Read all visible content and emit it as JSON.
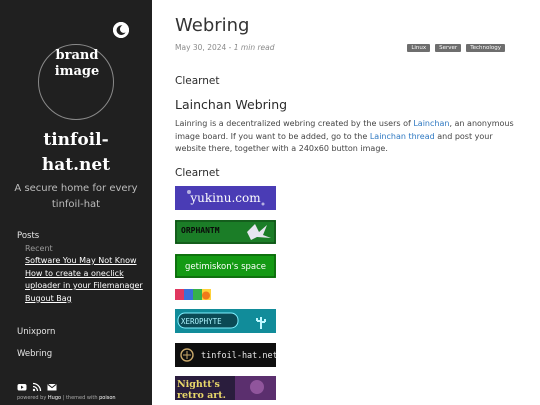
{
  "sidebar": {
    "brand_image_alt": "brand image",
    "site_title": "tinfoil-hat.net",
    "tagline": "A secure home for every tinfoil-hat",
    "nav": {
      "posts_label": "Posts",
      "recent_label": "Recent",
      "recent_posts": [
        "Software You May Not Know",
        "How to create a oneclick uploader in your Filemanager",
        "Bugout Bag"
      ],
      "unixporn_label": "Unixporn",
      "webring_label": "Webring"
    },
    "social_icons": [
      "youtube-icon",
      "rss-icon",
      "mail-icon"
    ],
    "footer": {
      "powered_by": "powered by",
      "hugo": "Hugo",
      "themed_with": "| themed with",
      "poison": "poison"
    }
  },
  "article": {
    "title": "Webring",
    "date": "May 30, 2024",
    "separator": " - ",
    "read_time": "1 min read",
    "tags": [
      "Linux",
      "Server",
      "Technology"
    ],
    "section_clearnet_1": "Clearnet",
    "heading": "Lainchan Webring",
    "para_1": "Lainring is a decentralized webring created by the users of ",
    "link_lainchan": "Lainchan",
    "para_2": ", an anonymous image board. If you want to be added, go to the ",
    "link_thread": "Lainchan thread",
    "para_3": " and post your website there, together with a 240x60 button image.",
    "section_clearnet_2": "Clearnet"
  },
  "webring_buttons": [
    {
      "label": "yukinu.com",
      "bg": "#4a3fb0"
    },
    {
      "label": "ORPHANTM",
      "bg": "#1b8a2a"
    },
    {
      "label": "getimiskon's space",
      "bg": "#1f9a1f"
    },
    {
      "label": "",
      "bg": "#d23a6c"
    },
    {
      "label": "XEROPHYTE",
      "bg": "#1a9aa8"
    },
    {
      "label": "tinfoil-hat.net",
      "bg": "#0e0e0e"
    },
    {
      "label": "Nightt's retro art",
      "bg": "#2a1d3d"
    }
  ]
}
